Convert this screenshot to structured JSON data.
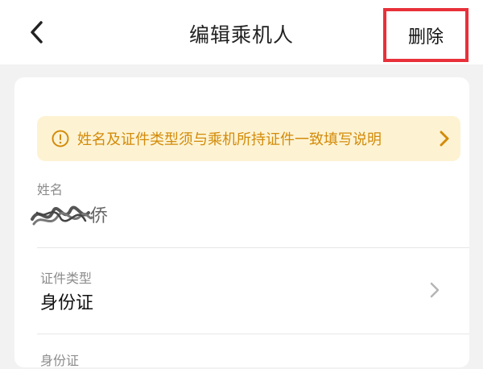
{
  "header": {
    "title": "编辑乘机人",
    "delete_label": "删除",
    "back_icon": "chevron-left-icon"
  },
  "notice": {
    "text": "姓名及证件类型须与乘机所持证件一致填写说明",
    "icon": "info-icon",
    "color": "#d38b0a",
    "background": "#fdf3d3"
  },
  "fields": {
    "name": {
      "label": "姓名",
      "value_visible": "侨"
    },
    "id_type": {
      "label": "证件类型",
      "value": "身份证"
    },
    "id_number": {
      "label": "身份证"
    }
  },
  "colors": {
    "highlight_border": "#e8313a",
    "page_bg": "#f2f2f2"
  }
}
